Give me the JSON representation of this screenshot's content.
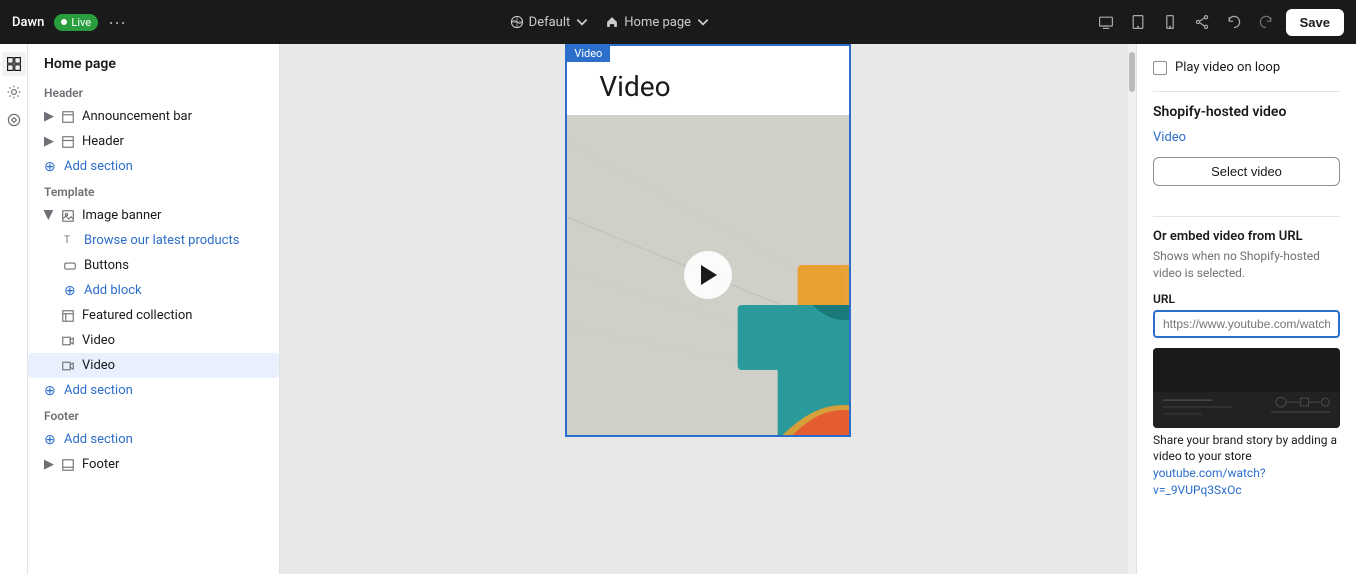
{
  "topbar": {
    "store_name": "Dawn",
    "live_label": "Live",
    "more_options_label": "...",
    "default_label": "Default",
    "home_page_label": "Home page",
    "save_label": "Save",
    "icons": {
      "globe": "🌐",
      "home": "⌂",
      "undo": "↩",
      "redo": "↪"
    }
  },
  "sidebar": {
    "title": "Home page",
    "header_group": "Header",
    "announcement_bar_label": "Announcement bar",
    "header_label": "Header",
    "add_section_label": "Add section",
    "template_group": "Template",
    "image_banner_label": "Image banner",
    "browse_products_label": "Browse our latest products",
    "buttons_label": "Buttons",
    "add_block_label": "Add block",
    "featured_collection_label": "Featured collection",
    "video1_label": "Video",
    "video2_label": "Video",
    "add_section2_label": "Add section",
    "footer_group": "Footer",
    "add_section3_label": "Add section",
    "footer_label": "Footer"
  },
  "canvas": {
    "section_title": "Video",
    "badge_label": "Video"
  },
  "right_panel": {
    "play_on_loop_label": "Play video on loop",
    "shopify_hosted_title": "Shopify-hosted video",
    "video_link_label": "Video",
    "select_video_btn_label": "Select video",
    "or_embed_title": "Or embed video from URL",
    "embed_desc": "Shows when no Shopify-hosted video is selected.",
    "url_label": "URL",
    "url_placeholder": "https://www.youtube.com/watch?v=",
    "cta_text": "Share your brand story by adding a video to your store",
    "cta_link": "youtube.com/watch?v=_9VUPq3SxOc"
  }
}
